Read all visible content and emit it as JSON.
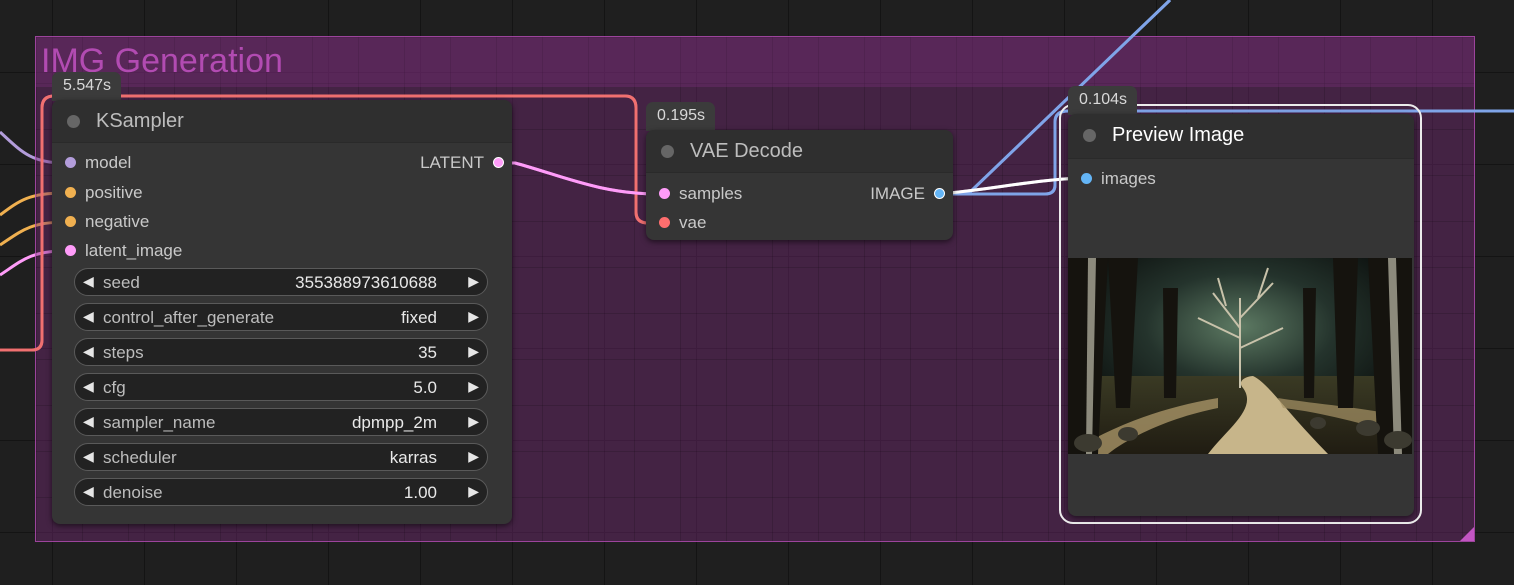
{
  "group": {
    "title": "IMG Generation"
  },
  "ksampler": {
    "timer": "5.547s",
    "title": "KSampler",
    "inputs": [
      "model",
      "positive",
      "negative",
      "latent_image"
    ],
    "output": "LATENT",
    "widgets": [
      {
        "label": "seed",
        "value": "355388973610688"
      },
      {
        "label": "control_after_generate",
        "value": "fixed"
      },
      {
        "label": "steps",
        "value": "35"
      },
      {
        "label": "cfg",
        "value": "5.0"
      },
      {
        "label": "sampler_name",
        "value": "dpmpp_2m"
      },
      {
        "label": "scheduler",
        "value": "karras"
      },
      {
        "label": "denoise",
        "value": "1.00"
      }
    ]
  },
  "vae_decode": {
    "timer": "0.195s",
    "title": "VAE Decode",
    "inputs": [
      "samples",
      "vae"
    ],
    "output": "IMAGE"
  },
  "preview_image": {
    "timer": "0.104s",
    "title": "Preview Image",
    "input": "images"
  },
  "icons": {
    "arrow_left": "◀",
    "arrow_right": "▶"
  },
  "colors": {
    "model": "#b39ddb",
    "conditioning": "#f0b050",
    "latent": "#ff9cf9",
    "vae": "#ff6e6e",
    "image": "#64b5f6",
    "group": "#a1309b"
  }
}
